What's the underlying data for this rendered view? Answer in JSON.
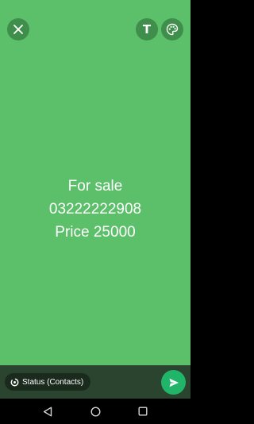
{
  "editor": {
    "tools": {
      "close_icon": "close-icon",
      "text_tool_label": "T",
      "palette_icon": "palette-icon"
    },
    "background_color": "#5cc06a",
    "text_lines": [
      "For sale",
      "03222222908",
      "Price 25000"
    ]
  },
  "footer": {
    "audience_label": "Status (Contacts)",
    "send_icon": "send-icon"
  },
  "system_nav": {
    "back_icon": "back-icon",
    "home_icon": "home-icon",
    "recents_icon": "recents-icon"
  }
}
